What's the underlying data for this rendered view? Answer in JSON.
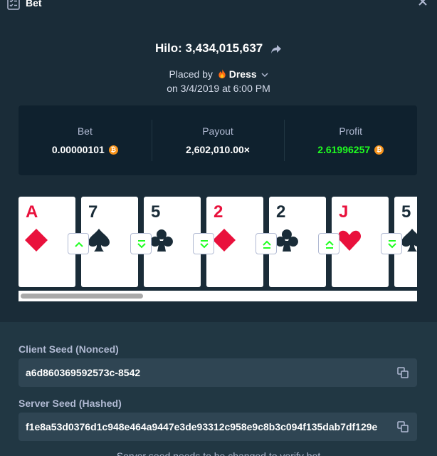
{
  "header": {
    "title": "Bet",
    "icon": "bet-list-icon"
  },
  "game": {
    "title": "Hilo: 3,434,015,637"
  },
  "placed": {
    "prefix": "Placed by",
    "user": "Dress",
    "date": "on 3/4/2019 at 6:00 PM"
  },
  "stats": {
    "bet": {
      "label": "Bet",
      "value": "0.00000101"
    },
    "payout": {
      "label": "Payout",
      "value": "2,602,010.00×"
    },
    "profit": {
      "label": "Profit",
      "value": "2.61996257"
    }
  },
  "cards": [
    {
      "rank": "A",
      "suit": "diamond",
      "color": "#e9113c"
    },
    {
      "rank": "7",
      "suit": "spade",
      "color": "#1a2c38"
    },
    {
      "rank": "5",
      "suit": "club",
      "color": "#1a2c38"
    },
    {
      "rank": "2",
      "suit": "diamond",
      "color": "#e9113c"
    },
    {
      "rank": "2",
      "suit": "club",
      "color": "#1a2c38"
    },
    {
      "rank": "J",
      "suit": "heart",
      "color": "#e9113c"
    },
    {
      "rank": "5",
      "suit": "spade",
      "color": "#1a2c38"
    }
  ],
  "guesses": [
    "higher",
    "lower-or-same",
    "lower-or-same",
    "higher-or-same",
    "higher-or-same",
    "lower-or-same"
  ],
  "seeds": {
    "client_label": "Client Seed (Nonced)",
    "client_value": "a6d860369592573c-8542",
    "server_label": "Server Seed (Hashed)",
    "server_value": "f1e8a53d0376d1c948e464a9447e3de93312c958e9c8b3c094f135dab7df129e",
    "notice": "Server seed needs to be changed to verify bet"
  },
  "colors": {
    "accent_green": "#1fff20",
    "bitcoin": "#f7931a",
    "red_suit": "#e9113c"
  }
}
